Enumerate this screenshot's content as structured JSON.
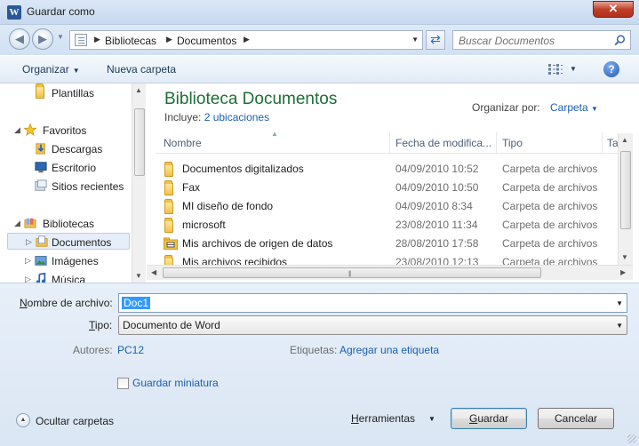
{
  "window": {
    "title": "Guardar como",
    "app_icon_letter": "W",
    "close_label": "✕"
  },
  "address": {
    "crumbs": [
      "Bibliotecas",
      "Documentos"
    ],
    "search_placeholder": "Buscar Documentos"
  },
  "toolbar": {
    "organize_label": "Organizar",
    "new_folder_label": "Nueva carpeta",
    "help_label": "?"
  },
  "nav": {
    "items": [
      {
        "label": "Plantillas",
        "icon": "folder-icon",
        "indent": 2
      },
      {
        "label": "Favoritos",
        "icon": "star-icon",
        "indent": 1,
        "expanded": true
      },
      {
        "label": "Descargas",
        "icon": "downloads-icon",
        "indent": 2
      },
      {
        "label": "Escritorio",
        "icon": "desktop-icon",
        "indent": 2
      },
      {
        "label": "Sitios recientes",
        "icon": "recent-places-icon",
        "indent": 2
      },
      {
        "label": "Bibliotecas",
        "icon": "libraries-icon",
        "indent": 1,
        "expanded": true
      },
      {
        "label": "Documentos",
        "icon": "documents-icon",
        "indent": 2,
        "selected": true
      },
      {
        "label": "Imágenes",
        "icon": "pictures-icon",
        "indent": 2
      },
      {
        "label": "Música",
        "icon": "music-icon",
        "indent": 2
      }
    ]
  },
  "library": {
    "title": "Biblioteca Documentos",
    "includes_label": "Incluye:",
    "includes_link": "2 ubicaciones",
    "arrange_label": "Organizar por:",
    "arrange_value": "Carpeta"
  },
  "columns": [
    "Nombre",
    "Fecha de modifica...",
    "Tipo",
    "Ta"
  ],
  "files": [
    {
      "name": "Documentos digitalizados",
      "date": "04/09/2010 10:52",
      "type": "Carpeta de archivos",
      "icon": "folder-icon"
    },
    {
      "name": "Fax",
      "date": "04/09/2010 10:50",
      "type": "Carpeta de archivos",
      "icon": "folder-icon"
    },
    {
      "name": "MI diseño de fondo",
      "date": "04/09/2010 8:34",
      "type": "Carpeta de archivos",
      "icon": "folder-icon"
    },
    {
      "name": "microsoft",
      "date": "23/08/2010 11:34",
      "type": "Carpeta de archivos",
      "icon": "folder-icon"
    },
    {
      "name": "Mis archivos de origen de datos",
      "date": "28/08/2010 17:58",
      "type": "Carpeta de archivos",
      "icon": "data-sources-folder-icon"
    },
    {
      "name": "Mis archivos recibidos",
      "date": "23/08/2010 12:13",
      "type": "Carpeta de archivos",
      "icon": "folder-icon"
    }
  ],
  "form": {
    "filename_label": "Nombre de archivo:",
    "filename_value": "Doc1",
    "type_label": "Tipo:",
    "type_value": "Documento de Word",
    "authors_label": "Autores:",
    "authors_value": "PC12",
    "tags_label": "Etiquetas:",
    "tags_value": "Agregar una etiqueta",
    "thumbnail_label": "Guardar miniatura",
    "thumbnail_checked": false
  },
  "footer": {
    "hide_folders_label": "Ocultar carpetas",
    "tools_label": "Herramientas",
    "save_label": "Guardar",
    "cancel_label": "Cancelar"
  },
  "colors": {
    "accent_link": "#1a5fb4",
    "library_title": "#1e6e35",
    "close_red": "#c0402a"
  }
}
